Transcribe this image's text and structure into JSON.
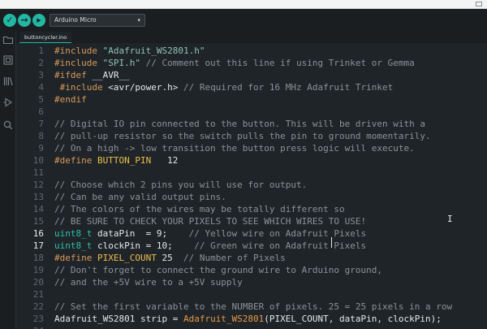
{
  "toolbar": {
    "board": "Arduino Micro",
    "icons": [
      "verify-icon",
      "upload-icon",
      "debug-icon",
      "chevron-down-icon"
    ]
  },
  "sidebar": {
    "icons": [
      "folder-icon",
      "boards-icon",
      "library-icon",
      "debug-icon",
      "search-icon"
    ]
  },
  "tab": {
    "name": "buttoncycler.ino"
  },
  "editor": {
    "active_lines": [
      16,
      17
    ],
    "lines": [
      {
        "n": "1",
        "segs": [
          {
            "t": "#include ",
            "c": "pp"
          },
          {
            "t": "\"Adafruit_WS2801.h\"",
            "c": "str"
          }
        ]
      },
      {
        "n": "2",
        "segs": [
          {
            "t": "#include ",
            "c": "pp"
          },
          {
            "t": "\"SPI.h\"",
            "c": "str"
          },
          {
            "t": " // Comment out this line if using Trinket or Gemma",
            "c": "cm"
          }
        ]
      },
      {
        "n": "3",
        "segs": [
          {
            "t": "#ifdef ",
            "c": "pp"
          },
          {
            "t": "__AVR__",
            "c": ""
          }
        ]
      },
      {
        "n": "4",
        "segs": [
          {
            "t": " #include ",
            "c": "pp"
          },
          {
            "t": "<avr/power.h>",
            "c": ""
          },
          {
            "t": " // Required for 16 MHz Adafruit Trinket",
            "c": "cm"
          }
        ]
      },
      {
        "n": "5",
        "segs": [
          {
            "t": "#endif",
            "c": "pp"
          }
        ]
      },
      {
        "n": "6",
        "segs": []
      },
      {
        "n": "7",
        "segs": [
          {
            "t": "// Digital IO pin connected to the button. This will be driven with a",
            "c": "cm"
          }
        ]
      },
      {
        "n": "8",
        "segs": [
          {
            "t": "// pull-up resistor so the switch pulls the pin to ground momentarily.",
            "c": "cm"
          }
        ]
      },
      {
        "n": "9",
        "segs": [
          {
            "t": "// On a high -> low transition the button press logic will execute.",
            "c": "cm"
          }
        ]
      },
      {
        "n": "10",
        "segs": [
          {
            "t": "#define ",
            "c": "pp"
          },
          {
            "t": "BUTTON_PIN",
            "c": "cn"
          },
          {
            "t": "   12",
            "c": ""
          }
        ]
      },
      {
        "n": "11",
        "segs": []
      },
      {
        "n": "12",
        "segs": [
          {
            "t": "// Choose which 2 pins you will use for output.",
            "c": "cm"
          }
        ]
      },
      {
        "n": "13",
        "segs": [
          {
            "t": "// Can be any valid output pins.",
            "c": "cm"
          }
        ]
      },
      {
        "n": "14",
        "segs": [
          {
            "t": "// The colors of the wires may be totally different so",
            "c": "cm"
          }
        ]
      },
      {
        "n": "15",
        "segs": [
          {
            "t": "// BE SURE TO CHECK YOUR PIXELS TO SEE WHICH WIRES TO USE!",
            "c": "cm"
          }
        ]
      },
      {
        "n": "16",
        "segs": [
          {
            "t": "uint8_t",
            "c": "ty"
          },
          {
            "t": " dataPin  = 9;    ",
            "c": ""
          },
          {
            "t": "// Yellow wire on Adafruit Pixels",
            "c": "cm"
          }
        ]
      },
      {
        "n": "17",
        "segs": [
          {
            "t": "uint8_t",
            "c": "ty"
          },
          {
            "t": " clockPin = 10;    ",
            "c": ""
          },
          {
            "t": "// Green wire on Adafruit Pixels",
            "c": "cm"
          }
        ]
      },
      {
        "n": "18",
        "segs": [
          {
            "t": "#define ",
            "c": "pp"
          },
          {
            "t": "PIXEL_COUNT",
            "c": "cn"
          },
          {
            "t": " 25  ",
            "c": ""
          },
          {
            "t": "// Number of Pixels",
            "c": "cm"
          }
        ]
      },
      {
        "n": "19",
        "segs": [
          {
            "t": "// Don't forget to connect the ground wire to Arduino ground,",
            "c": "cm"
          }
        ]
      },
      {
        "n": "20",
        "segs": [
          {
            "t": "// and the +5V wire to a +5V supply",
            "c": "cm"
          }
        ]
      },
      {
        "n": "21",
        "segs": []
      },
      {
        "n": "22",
        "segs": [
          {
            "t": "// Set the first variable to the NUMBER of pixels. 25 = 25 pixels in a row",
            "c": "cm"
          }
        ]
      },
      {
        "n": "23",
        "segs": [
          {
            "t": "Adafruit_WS2801 strip = ",
            "c": ""
          },
          {
            "t": "Adafruit_WS2801",
            "c": "fn"
          },
          {
            "t": "(PIXEL_COUNT, dataPin, clockPin);",
            "c": ""
          }
        ]
      },
      {
        "n": "24",
        "segs": []
      }
    ]
  },
  "colors": {
    "accent": "#22b8a4",
    "background": "#1f2428",
    "chrome": "#1a1e21",
    "preprocessor": "#d99a5b",
    "string": "#8fc2b7",
    "comment": "#8b9297",
    "type": "#2fc0a8",
    "constant": "#ecbe4f",
    "function": "#e79a4a"
  }
}
